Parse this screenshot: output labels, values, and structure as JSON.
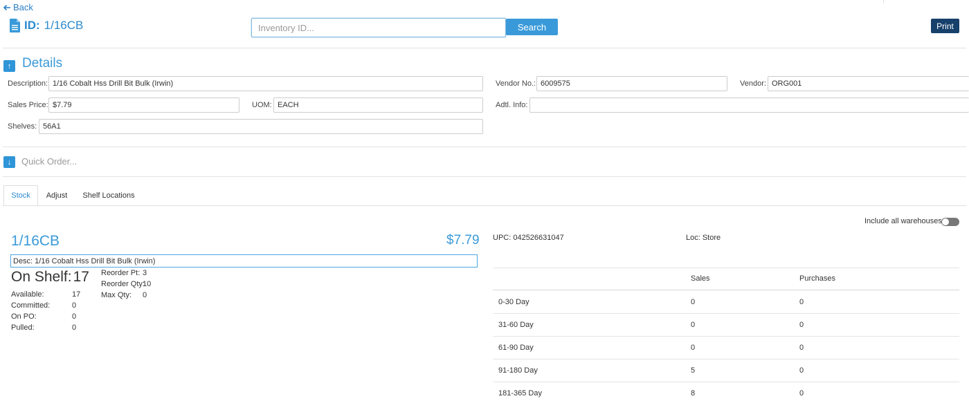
{
  "header": {
    "back_label": "Back",
    "id_prefix": "ID:",
    "id_value": "1/16CB",
    "search_placeholder": "Inventory ID...",
    "search_label": "Search",
    "print_label": "Print"
  },
  "details": {
    "title": "Details",
    "description_label": "Description:",
    "description_value": "1/16 Cobalt Hss Drill Bit Bulk (Irwin)",
    "vendor_no_label": "Vendor No.:",
    "vendor_no_value": "6009575",
    "vendor_label": "Vendor:",
    "vendor_value": "ORG001",
    "sales_price_label": "Sales Price:",
    "sales_price_value": "$7.79",
    "uom_label": "UOM:",
    "uom_value": "EACH",
    "adtl_info_label": "Adtl. Info:",
    "adtl_info_value": "",
    "shelves_label": "Shelves:",
    "shelves_value": "56A1"
  },
  "quick_order": {
    "label": "Quick Order..."
  },
  "tabs": [
    {
      "label": "Stock",
      "active": true
    },
    {
      "label": "Adjust",
      "active": false
    },
    {
      "label": "Shelf Locations",
      "active": false
    }
  ],
  "stock": {
    "include_all_label": "Include all warehouses",
    "include_all_on": false,
    "item_id": "1/16CB",
    "price": "$7.79",
    "desc": "Desc: 1/16 Cobalt Hss Drill Bit Bulk (Irwin)",
    "on_shelf_label": "On Shelf:",
    "on_shelf_value": "17",
    "available_label": "Available:",
    "available_value": "17",
    "committed_label": "Committed:",
    "committed_value": "0",
    "on_po_label": "On PO:",
    "on_po_value": "0",
    "pulled_label": "Pulled:",
    "pulled_value": "0",
    "reorder_pt_label": "Reorder Pt:",
    "reorder_pt_value": "3",
    "reorder_qty_label": "Reorder Qty:",
    "reorder_qty_value": "10",
    "max_qty_label": "Max Qty:",
    "max_qty_value": "0",
    "upc": "UPC: 042526631047",
    "loc": "Loc: Store"
  },
  "history": {
    "headers": [
      "",
      "Sales",
      "Purchases"
    ],
    "rows": [
      [
        "0-30 Day",
        "0",
        "0"
      ],
      [
        "31-60 Day",
        "0",
        "0"
      ],
      [
        "61-90 Day",
        "0",
        "0"
      ],
      [
        "91-180 Day",
        "5",
        "0"
      ],
      [
        "181-365 Day",
        "8",
        "0"
      ]
    ]
  }
}
